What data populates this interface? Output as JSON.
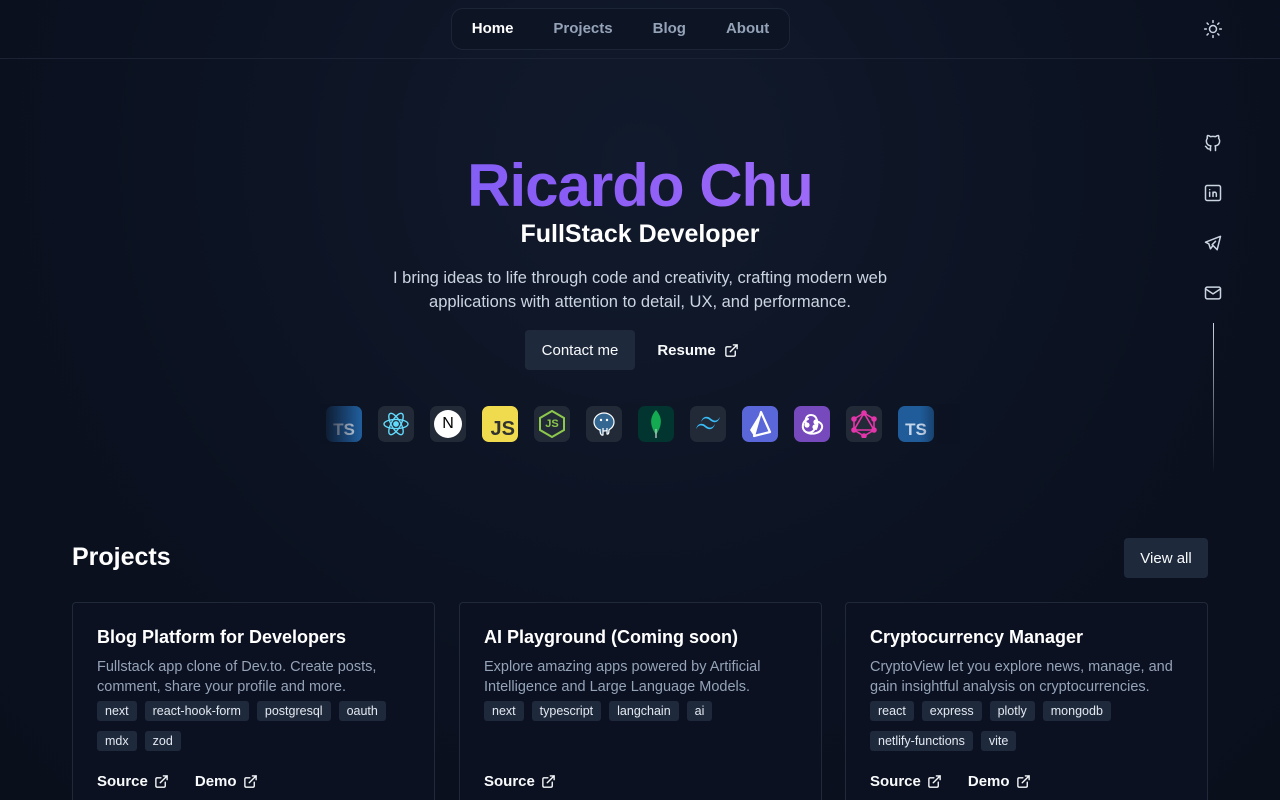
{
  "nav": {
    "items": [
      {
        "label": "Home",
        "active": true
      },
      {
        "label": "Projects",
        "active": false
      },
      {
        "label": "Blog",
        "active": false
      },
      {
        "label": "About",
        "active": false
      }
    ],
    "theme_icon": "sun-icon"
  },
  "social": {
    "icons": [
      "github-icon",
      "linkedin-icon",
      "telegram-icon",
      "mail-icon"
    ]
  },
  "hero": {
    "name": "Ricardo Chu",
    "role": "FullStack Developer",
    "description": "I bring ideas to life through code and creativity, crafting modern web applications with attention to detail, UX, and performance.",
    "contact_label": "Contact me",
    "resume_label": "Resume",
    "gradient_colors": [
      "#6366f1",
      "#8b5cf6",
      "#c084fc"
    ]
  },
  "tech_stack": [
    {
      "name": "typescript-icon",
      "text": "TS"
    },
    {
      "name": "react-icon",
      "text": ""
    },
    {
      "name": "nextjs-icon",
      "text": "N"
    },
    {
      "name": "javascript-icon",
      "text": "JS"
    },
    {
      "name": "nodejs-icon",
      "text": "JS"
    },
    {
      "name": "postgresql-icon",
      "text": ""
    },
    {
      "name": "mongodb-icon",
      "text": ""
    },
    {
      "name": "tailwind-icon",
      "text": ""
    },
    {
      "name": "prisma-icon",
      "text": ""
    },
    {
      "name": "redux-icon",
      "text": ""
    },
    {
      "name": "graphql-icon",
      "text": ""
    },
    {
      "name": "typescript-icon",
      "text": "TS"
    }
  ],
  "projects": {
    "title": "Projects",
    "view_all_label": "View all",
    "cards": [
      {
        "title": "Blog Platform for Developers",
        "description": "Fullstack app clone of Dev.to. Create posts, comment, share your profile and more.",
        "tags": [
          "next",
          "react-hook-form",
          "postgresql",
          "oauth",
          "mdx",
          "zod"
        ],
        "links": [
          "Source",
          "Demo"
        ]
      },
      {
        "title": "AI Playground (Coming soon)",
        "description": "Explore amazing apps powered by Artificial Intelligence and Large Language Models.",
        "tags": [
          "next",
          "typescript",
          "langchain",
          "ai"
        ],
        "links": [
          "Source"
        ]
      },
      {
        "title": "Cryptocurrency Manager",
        "description": "CryptoView let you explore news, manage, and gain insightful analysis on cryptocurrencies.",
        "tags": [
          "react",
          "express",
          "plotly",
          "mongodb",
          "netlify-functions",
          "vite"
        ],
        "links": [
          "Source",
          "Demo"
        ]
      }
    ]
  }
}
